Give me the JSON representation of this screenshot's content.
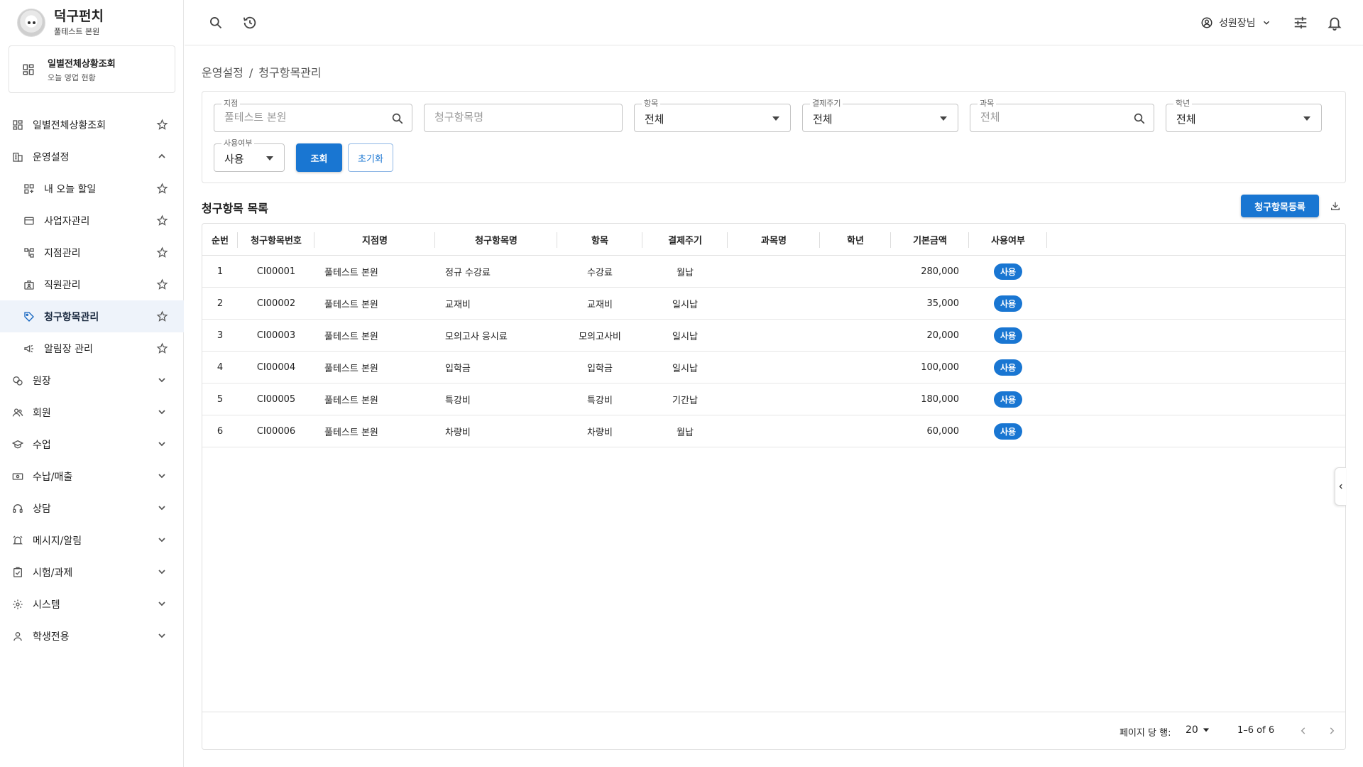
{
  "brand": {
    "name": "덕구펀치",
    "branch": "풀테스트 본원"
  },
  "shortcut": {
    "title": "일별전체상황조회",
    "subtitle": "오늘 영업 현황"
  },
  "nav": {
    "items": [
      {
        "label": "일별전체상황조회",
        "icon": "dashboard-icon",
        "right": "star"
      },
      {
        "label": "운영설정",
        "icon": "building-icon",
        "right": "chevron-up"
      },
      {
        "label": "내 오늘 할일",
        "icon": "tasks-icon",
        "right": "star",
        "sub": true
      },
      {
        "label": "사업자관리",
        "icon": "card-icon",
        "right": "star",
        "sub": true
      },
      {
        "label": "지점관리",
        "icon": "branch-icon",
        "right": "star",
        "sub": true
      },
      {
        "label": "직원관리",
        "icon": "staff-icon",
        "right": "star",
        "sub": true
      },
      {
        "label": "청구항목관리",
        "icon": "tag-icon",
        "right": "star",
        "sub": true,
        "active": true
      },
      {
        "label": "알림장 관리",
        "icon": "megaphone-icon",
        "right": "star",
        "sub": true
      },
      {
        "label": "원장",
        "icon": "ledger-icon",
        "right": "chevron-down"
      },
      {
        "label": "회원",
        "icon": "members-icon",
        "right": "chevron-down"
      },
      {
        "label": "수업",
        "icon": "school-icon",
        "right": "chevron-down"
      },
      {
        "label": "수납/매출",
        "icon": "money-icon",
        "right": "chevron-down"
      },
      {
        "label": "상담",
        "icon": "headset-icon",
        "right": "chevron-down"
      },
      {
        "label": "메시지/알림",
        "icon": "alarm-icon",
        "right": "chevron-down"
      },
      {
        "label": "시험/과제",
        "icon": "checklist-icon",
        "right": "chevron-down"
      },
      {
        "label": "시스템",
        "icon": "gear-icon",
        "right": "chevron-down"
      },
      {
        "label": "학생전용",
        "icon": "person-icon",
        "right": "chevron-down"
      }
    ]
  },
  "topbar": {
    "user_name": "성원장님"
  },
  "breadcrumb": {
    "parent": "운영설정",
    "sep": "/",
    "current": "청구항목관리"
  },
  "filters": {
    "branch": {
      "label": "지점",
      "placeholder": "풀테스트 본원"
    },
    "item_name": {
      "placeholder": "청구항목명"
    },
    "category": {
      "label": "항목",
      "value": "전체"
    },
    "cycle": {
      "label": "결제주기",
      "value": "전체"
    },
    "subject": {
      "label": "과목",
      "placeholder": "전체"
    },
    "grade": {
      "label": "학년",
      "value": "전체"
    },
    "usage": {
      "label": "사용여부",
      "value": "사용"
    },
    "search_button": "조회",
    "reset_button": "초기화"
  },
  "list": {
    "title": "청구항목 목록",
    "register_button": "청구항목등록"
  },
  "table": {
    "columns": [
      "순번",
      "청구항목번호",
      "지점명",
      "청구항목명",
      "항목",
      "결제주기",
      "과목명",
      "학년",
      "기본금액",
      "사용여부"
    ],
    "rows": [
      {
        "no": "1",
        "code": "CI00001",
        "branch": "풀테스트 본원",
        "name": "정규 수강료",
        "category": "수강료",
        "cycle": "월납",
        "subject": "",
        "grade": "",
        "amount": "280,000",
        "usage": "사용"
      },
      {
        "no": "2",
        "code": "CI00002",
        "branch": "풀테스트 본원",
        "name": "교재비",
        "category": "교재비",
        "cycle": "일시납",
        "subject": "",
        "grade": "",
        "amount": "35,000",
        "usage": "사용"
      },
      {
        "no": "3",
        "code": "CI00003",
        "branch": "풀테스트 본원",
        "name": "모의고사 응시료",
        "category": "모의고사비",
        "cycle": "일시납",
        "subject": "",
        "grade": "",
        "amount": "20,000",
        "usage": "사용"
      },
      {
        "no": "4",
        "code": "CI00004",
        "branch": "풀테스트 본원",
        "name": "입학금",
        "category": "입학금",
        "cycle": "일시납",
        "subject": "",
        "grade": "",
        "amount": "100,000",
        "usage": "사용"
      },
      {
        "no": "5",
        "code": "CI00005",
        "branch": "풀테스트 본원",
        "name": "특강비",
        "category": "특강비",
        "cycle": "기간납",
        "subject": "",
        "grade": "",
        "amount": "180,000",
        "usage": "사용"
      },
      {
        "no": "6",
        "code": "CI00006",
        "branch": "풀테스트 본원",
        "name": "차량비",
        "category": "차량비",
        "cycle": "월납",
        "subject": "",
        "grade": "",
        "amount": "60,000",
        "usage": "사용"
      }
    ]
  },
  "pagination": {
    "rows_per_page_label": "페이지 당 행:",
    "rows_per_page": "20",
    "range": "1–6 of 6"
  },
  "colors": {
    "primary": "#1976d2",
    "active_bg": "#eef3fa"
  }
}
